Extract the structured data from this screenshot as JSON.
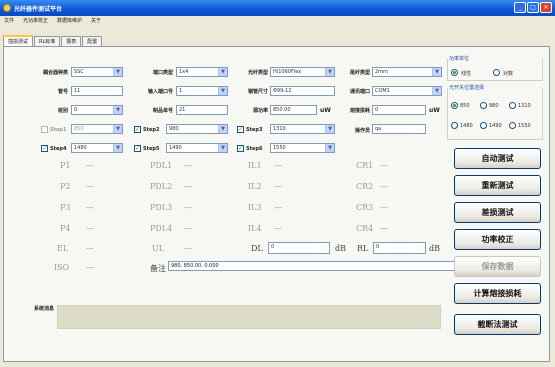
{
  "window": {
    "title": "光纤器件测试平台",
    "minimize": "_",
    "maximize": "□",
    "close": "✕"
  },
  "menu": [
    "文件",
    "光功率校正",
    "数据库维护",
    "关于"
  ],
  "tabs": [
    "插损测试",
    "RL标准",
    "报表",
    "配置"
  ],
  "form": {
    "coupler_type": {
      "label": "耦合器种类",
      "value": "SSC"
    },
    "port_type": {
      "label": "端口类型",
      "value": "1x4"
    },
    "fiber_type": {
      "label": "光纤类型",
      "value": "HI1060Flex"
    },
    "tail_type": {
      "label": "尾纤类型",
      "value": "2mm"
    },
    "group_no": {
      "label": "管号",
      "value": "11"
    },
    "input_port_no": {
      "label": "输入端口号",
      "value": "1"
    },
    "pin_size": {
      "label": "钢管尺寸",
      "value": "Φ99-12"
    },
    "comm_port": {
      "label": "通讯端口",
      "value": "COM1"
    },
    "batch": {
      "label": "班别",
      "value": "0"
    },
    "product_no": {
      "label": "制品单号",
      "value": "21"
    },
    "source_power": {
      "label": "源功率",
      "value": "850.00",
      "unit": "uW"
    },
    "splice_loss": {
      "label": "熔接损耗",
      "value": "0",
      "unit": "uW"
    },
    "operator": {
      "label": "操作员",
      "value": "qa"
    }
  },
  "steps": [
    {
      "label": "Step1",
      "value": "850",
      "checked": "",
      "enabled": false
    },
    {
      "label": "Step2",
      "value": "980",
      "checked": "✓",
      "enabled": true
    },
    {
      "label": "Step3",
      "value": "1310",
      "checked": "✓",
      "enabled": true
    },
    {
      "label": "Step4",
      "value": "1480",
      "checked": "✓",
      "enabled": true
    },
    {
      "label": "Step5",
      "value": "1490",
      "checked": "✓",
      "enabled": true
    },
    {
      "label": "Step6",
      "value": "1550",
      "checked": "✓",
      "enabled": true
    }
  ],
  "results": {
    "P1": "P1",
    "P2": "P2",
    "P3": "P3",
    "P4": "P4",
    "PDL1": "PDL1",
    "PDL2": "PDL2",
    "PDL3": "PDL3",
    "PDL4": "PDL4",
    "IL1": "IL1",
    "IL2": "IL2",
    "IL3": "IL3",
    "IL4": "IL4",
    "CR1": "CR1",
    "CR2": "CR2",
    "CR3": "CR3",
    "CR4": "CR4",
    "EL": "EL",
    "UL": "UL",
    "ISO": "ISO",
    "dash": "—"
  },
  "dl": {
    "label": "DL",
    "value": "0",
    "unit": "dB"
  },
  "rl": {
    "label": "RL",
    "value": "0",
    "unit": "dB"
  },
  "remark": {
    "label": "备注",
    "value": "980, 850.00, 0.000"
  },
  "system_message": {
    "label": "系统消息"
  },
  "power_unit": {
    "title": "功率单位",
    "option1": "线性",
    "option2": "对数",
    "selected": "线性"
  },
  "wavelength": {
    "title": "光开关位置选择",
    "options": [
      "850",
      "980",
      "1310",
      "1480",
      "1490",
      "1550"
    ],
    "selected": "850"
  },
  "buttons": {
    "auto_test": "自动测试",
    "retest": "重新测试",
    "diff_loss": "差损测试",
    "power_cal": "功率校正",
    "save_data": "保存数据",
    "calc_splice": "计算熔接损耗",
    "cutback": "截断法测试"
  }
}
